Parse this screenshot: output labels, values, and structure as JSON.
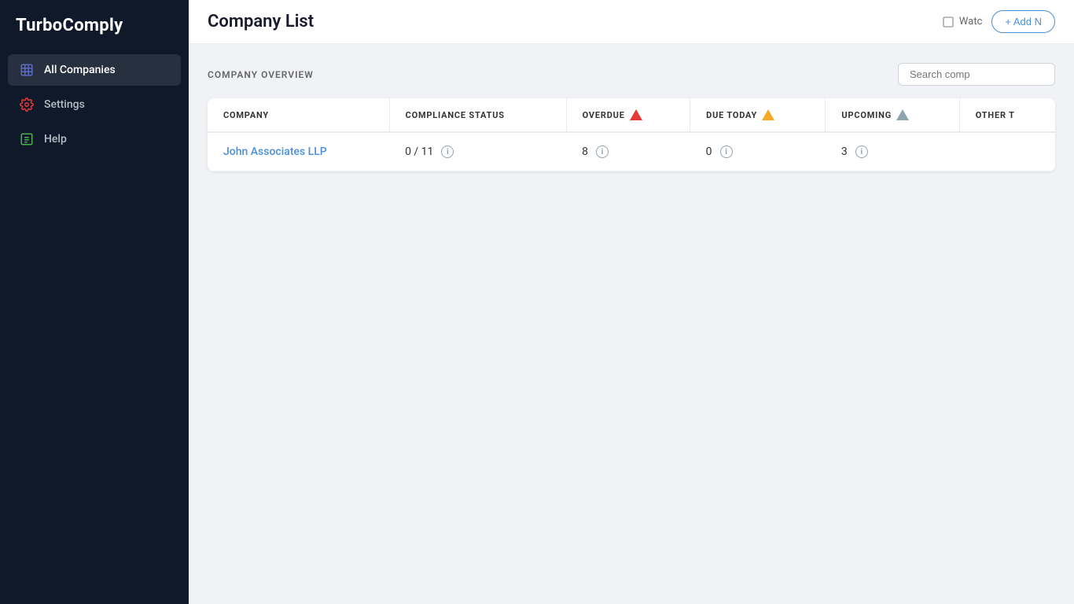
{
  "app": {
    "name": "TurboComply"
  },
  "sidebar": {
    "items": [
      {
        "id": "all-companies",
        "label": "All Companies",
        "icon": "building",
        "active": true
      },
      {
        "id": "settings",
        "label": "Settings",
        "icon": "gear",
        "active": false
      },
      {
        "id": "help",
        "label": "Help",
        "icon": "help",
        "active": false
      }
    ]
  },
  "topbar": {
    "title": "Company List",
    "add_button": "+ Add N",
    "watchtower_label": "Watc"
  },
  "content": {
    "section_title": "COMPANY OVERVIEW",
    "search_placeholder": "Search comp"
  },
  "table": {
    "columns": [
      {
        "id": "company",
        "label": "COMPANY",
        "icon": null
      },
      {
        "id": "compliance_status",
        "label": "COMPLIANCE STATUS",
        "icon": null
      },
      {
        "id": "overdue",
        "label": "OVERDUE",
        "icon": "triangle-red"
      },
      {
        "id": "due_today",
        "label": "DUE TODAY",
        "icon": "triangle-yellow"
      },
      {
        "id": "upcoming",
        "label": "UPCOMING",
        "icon": "triangle-gray"
      },
      {
        "id": "other",
        "label": "OTHER T",
        "icon": null
      }
    ],
    "rows": [
      {
        "company": "John Associates LLP",
        "compliance_status": "0 / 11",
        "overdue": "8",
        "due_today": "0",
        "upcoming": "3",
        "other": ""
      }
    ]
  }
}
